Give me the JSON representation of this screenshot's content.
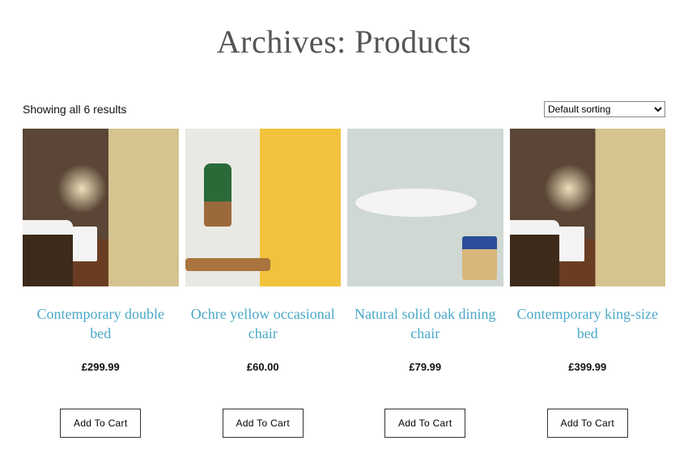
{
  "header": {
    "title": "Archives: Products"
  },
  "toolbar": {
    "result_count": "Showing all 6 results",
    "sort_selected": "Default sorting"
  },
  "products": [
    {
      "title": "Contemporary double bed",
      "price": "£299.99",
      "add_label": "Add To Cart",
      "thumb": "bedroom"
    },
    {
      "title": "Ochre yellow occasional chair",
      "price": "£60.00",
      "add_label": "Add To Cart",
      "thumb": "chair"
    },
    {
      "title": "Natural solid oak dining chair",
      "price": "£79.99",
      "add_label": "Add To Cart",
      "thumb": "table"
    },
    {
      "title": "Contemporary king-size bed",
      "price": "£399.99",
      "add_label": "Add To Cart",
      "thumb": "bedroom"
    }
  ]
}
